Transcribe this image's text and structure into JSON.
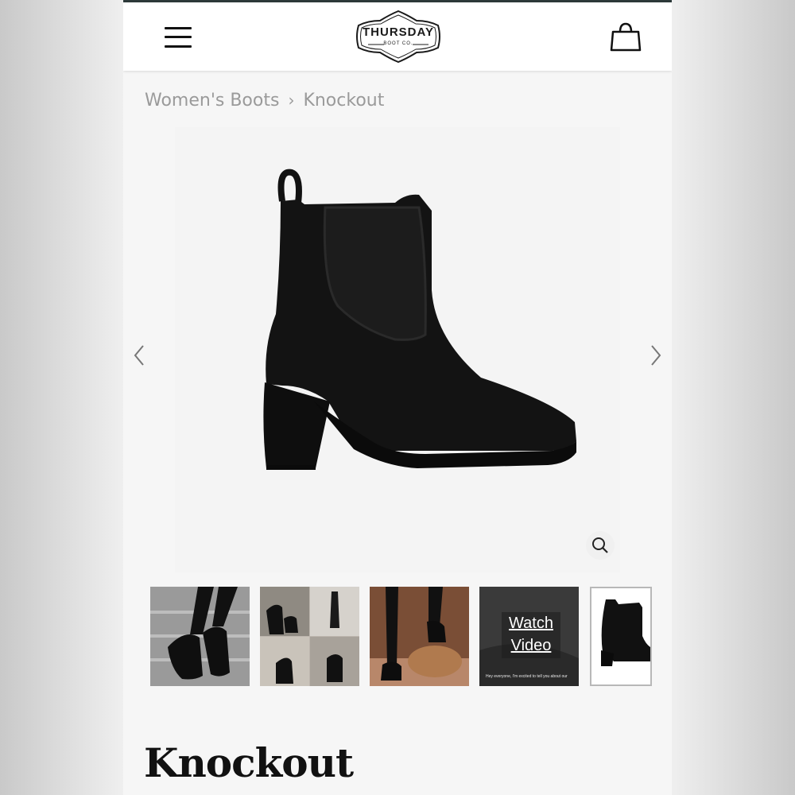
{
  "header": {
    "logo_main": "THURSDAY",
    "logo_sub": "BOOT CO.",
    "menu_icon": "hamburger-menu-icon",
    "cart_icon": "shopping-bag-icon"
  },
  "breadcrumb": {
    "parent": "Women's Boots",
    "separator": "›",
    "current": "Knockout"
  },
  "gallery": {
    "prev_icon": "chevron-left-icon",
    "next_icon": "chevron-right-icon",
    "zoom_icon": "magnifier-icon",
    "thumbnails": [
      {
        "type": "lifestyle-photo"
      },
      {
        "type": "collage-photo"
      },
      {
        "type": "lifestyle-photo"
      },
      {
        "type": "video",
        "label": "Watch Video",
        "caption": "Hey everyone, I'm excited to tell you about our"
      },
      {
        "type": "product-photo",
        "selected": true
      }
    ]
  },
  "product": {
    "title": "Knockout"
  },
  "colors": {
    "accent_stripe": "#2d3a3a",
    "breadcrumb_text": "#9a9a9a",
    "boot": "#111111"
  }
}
